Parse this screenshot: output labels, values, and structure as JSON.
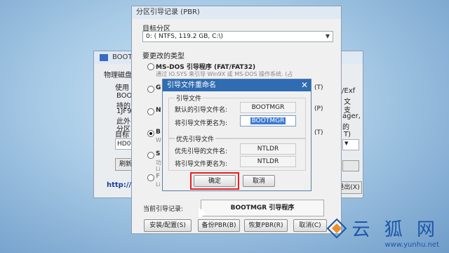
{
  "bg_window": {
    "title": "BOOT",
    "tab": "物理磁盘",
    "use_label": "使用",
    "body_lines": [
      "BOOT",
      "持的",
      "1JF9",
      "此外",
      "分区"
    ],
    "target_label": "目标",
    "disk_value": "HD0:",
    "refresh_button": "刷新",
    "link": "http://w",
    "right_texts": [
      "/Exf",
      "文",
      "支",
      "ager,",
      "的"
    ],
    "right_t_suffix": "T)",
    "exit_button": "退出(X)"
  },
  "pbr_window": {
    "title": "分区引导记录 (PBR)",
    "target_partition_label": "目标分区",
    "partition_value": "0: ( NTFS, 119.2 GB, C:\\)",
    "change_type_label": "要更改的类型",
    "options": [
      {
        "title": "MS-DOS 引导程序 (FAT/FAT32)",
        "desc": "通过 IO.SYS 来引导 Win9X 或 MS-DOS 操作系统. (占",
        "selected": false
      },
      {
        "title": "G",
        "desc": "",
        "selected": false
      },
      {
        "title": "N",
        "desc": "",
        "selected": false
      },
      {
        "title": "B",
        "desc": "W",
        "selected": true
      },
      {
        "title": "S",
        "desc": "功",
        "selected": false
      },
      {
        "title": "F",
        "desc": "",
        "selected": false
      }
    ],
    "option_desc_extra": [
      "Li",
      "Li"
    ],
    "right_labels": [
      "(T)",
      "(P)",
      "(T)"
    ],
    "current_record_label": "当前引导记录:",
    "current_record_value": "BOOTMGR 引导程序",
    "buttons": {
      "install": "安装/配置(S)",
      "backup": "备份PBR(B)",
      "restore": "恢复PBR(R)",
      "cancel": "取消(C)"
    }
  },
  "rename_dialog": {
    "title": "引导文件重命名",
    "group1_title": "引导文件",
    "default_label": "默认的引导文件名:",
    "default_value": "BOOTMGR",
    "rename_label": "将引导文件更名为:",
    "rename_value": "BOOTMGR",
    "group2_title": "优先引导文件",
    "priority_label": "优先引导的文件名:",
    "priority_value": "NTLDR",
    "priority_rename_label": "将引导文件更名为:",
    "priority_rename_value": "NTLDR",
    "ok_button": "确定",
    "cancel_button": "取消"
  },
  "watermark": {
    "logo": "云 狐 网",
    "url": "www.yunhu.net"
  },
  "colors": {
    "dialog_title_bg": "#2f6cb2",
    "highlight_box": "#e52121",
    "selection_bg": "#3a78d4",
    "watermark": "#1b56a8"
  }
}
